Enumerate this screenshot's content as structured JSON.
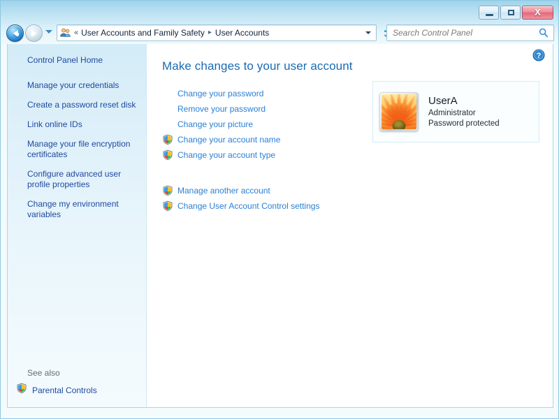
{
  "window": {
    "frame_color": "#b3ddf0",
    "buttons": {
      "minimize": {
        "name": "Minimize",
        "glyph": "minimize-icon"
      },
      "maximize": {
        "name": "Maximize",
        "glyph": "maximize-icon"
      },
      "close": {
        "name": "Close",
        "glyph": "X"
      }
    }
  },
  "navigation": {
    "back_tooltip": "Back",
    "forward_tooltip": "Forward",
    "recent_pages_tooltip": "Recent pages",
    "refresh_glyph": "↻",
    "breadcrumb": {
      "icon": "user-accounts-icon",
      "overflow_chevrons": "«",
      "separator": "▸",
      "items": [
        {
          "label": "User Accounts and Family Safety"
        },
        {
          "label": "User Accounts"
        }
      ]
    },
    "search": {
      "placeholder": "Search Control Panel",
      "value": "",
      "icon": "search-icon"
    }
  },
  "sidebar": {
    "home_label": "Control Panel Home",
    "items": [
      {
        "label": "Manage your credentials"
      },
      {
        "label": "Create a password reset disk"
      },
      {
        "label": "Link online IDs"
      },
      {
        "label": "Manage your file encryption certificates"
      },
      {
        "label": "Configure advanced user profile properties"
      },
      {
        "label": "Change my environment variables"
      }
    ],
    "see_also": {
      "title": "See also",
      "items": [
        {
          "label": "Parental Controls",
          "icon": "shield-icon"
        }
      ]
    },
    "link_color": "#1f49a0",
    "background_color": "#ddf0f9"
  },
  "content": {
    "help_tooltip": "Help",
    "help_icon": "help-icon",
    "title": "Make changes to your user account",
    "title_color": "#1a6bb5",
    "tasks": [
      {
        "label": "Change your password",
        "shield": false
      },
      {
        "label": "Remove your password",
        "shield": false
      },
      {
        "label": "Change your picture",
        "shield": false
      },
      {
        "label": "Change your account name",
        "shield": true
      },
      {
        "label": "Change your account type",
        "shield": true
      }
    ],
    "tasks_secondary": [
      {
        "label": "Manage another account",
        "shield": true
      },
      {
        "label": "Change User Account Control settings",
        "shield": true
      }
    ],
    "link_color": "#2a7fd4"
  },
  "account": {
    "avatar_icon": "user-picture-flower",
    "name": "UserA",
    "account_type": "Administrator",
    "password_status": "Password protected"
  }
}
